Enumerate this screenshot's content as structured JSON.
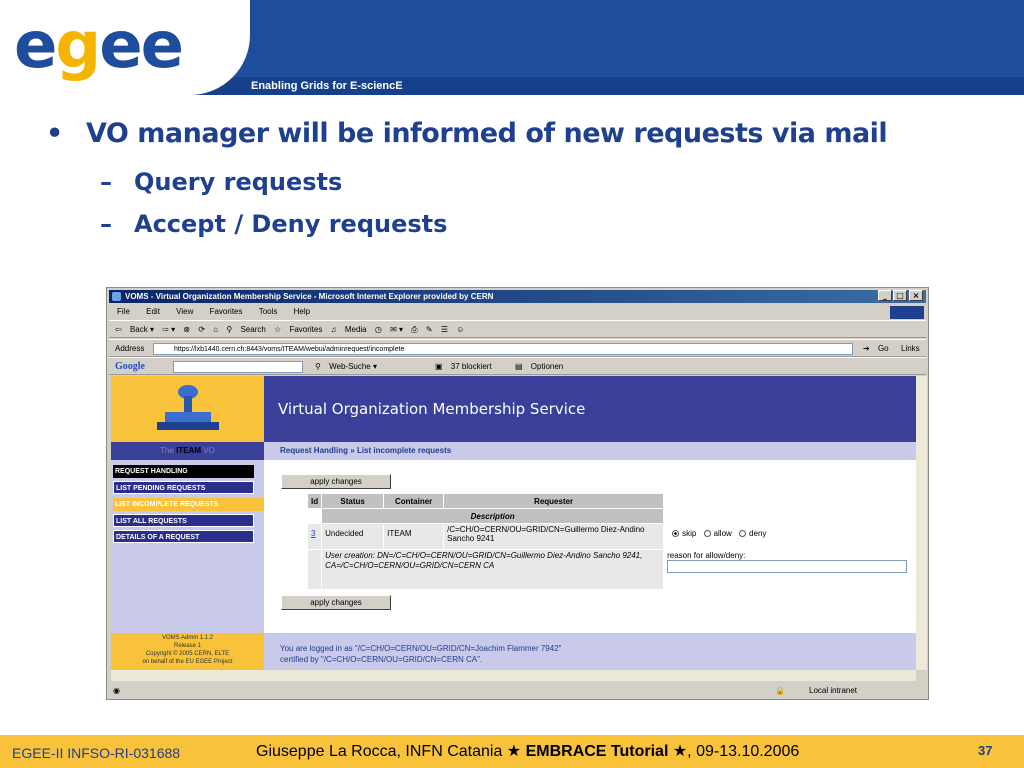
{
  "header": {
    "logo": "egee",
    "tagline": "Enabling Grids for E-sciencE"
  },
  "bullets": {
    "main": "VO manager will be informed of new requests via mail",
    "sub1": "Query requests",
    "sub2": "Accept / Deny requests"
  },
  "browser": {
    "title": "VOMS - Virtual Organization Membership Service - Microsoft Internet Explorer provided by CERN",
    "menus": [
      "File",
      "Edit",
      "View",
      "Favorites",
      "Tools",
      "Help"
    ],
    "toolbar": {
      "back": "Back",
      "search": "Search",
      "favorites": "Favorites",
      "media": "Media"
    },
    "address_label": "Address",
    "url": "https://lxb1440.cern.ch:8443/voms/ITEAM/webui/adminrequest/incomplete",
    "go": "Go",
    "links": "Links",
    "google": {
      "label": "Google",
      "web_search": "Web-Suche",
      "blocked": "37 blockiert",
      "options": "Optionen"
    },
    "status_zone": "Local intranet"
  },
  "voms": {
    "heading": "Virtual Organization Membership Service",
    "vo_prefix": "The",
    "vo_name": "ITEAM",
    "vo_suffix": "VO",
    "breadcrumb_a": "Request Handling",
    "breadcrumb_sep": "»",
    "breadcrumb_b": "List incomplete requests",
    "nav": [
      "REQUEST HANDLING",
      "LIST PENDING REQUESTS",
      "LIST INCOMPLETE REQUESTS",
      "LIST ALL REQUESTS",
      "DETAILS OF A REQUEST"
    ],
    "apply_label": "apply changes",
    "table": {
      "headers": [
        "Id",
        "Status",
        "Container",
        "Requester"
      ],
      "description_header": "Description",
      "row": {
        "id": "3",
        "status": "Undecided",
        "container": "ITEAM",
        "requester": "/C=CH/O=CERN/OU=GRID/CN=Guillermo Diez-Andino Sancho 9241",
        "options": [
          "skip",
          "allow",
          "deny"
        ],
        "description": "User creation: DN=/C=CH/O=CERN/OU=GRID/CN=Guillermo Diez-Andino Sancho 9241, CA=/C=CH/O=CERN/OU=GRID/CN=CERN CA",
        "reason_label": "reason for allow/deny:"
      }
    },
    "footer_left": [
      "VOMS Admin 1.1.2",
      "Release 1",
      "Copyright © 2005 CERN, ELTE",
      "on behalf of the EU EGEE Project"
    ],
    "logged_in": "You are logged in as \"/C=CH/O=CERN/OU=GRID/CN=Joachim Flammer 7942\"",
    "certified": "certified by \"/C=CH/O=CERN/OU=GRID/CN=CERN CA\"."
  },
  "footer": {
    "left": "EGEE-II INFSO-RI-031688",
    "center_a": "Giuseppe La Rocca, INFN Catania ★ ",
    "center_b": "EMBRACE Tutorial",
    "center_c": " ★, 09-13.10.2006",
    "page": "37"
  }
}
